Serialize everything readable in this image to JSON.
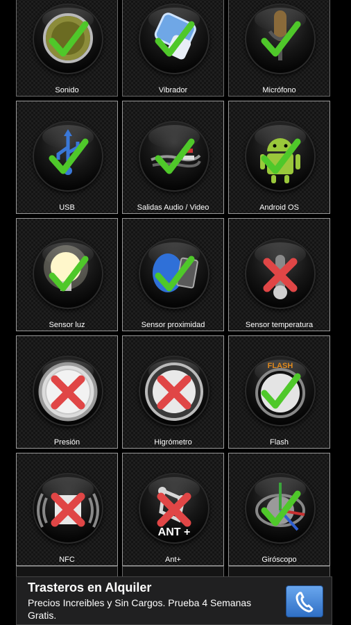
{
  "tiles": [
    {
      "label": "Sonido",
      "icon": "speaker-icon",
      "status": "ok"
    },
    {
      "label": "Vibrador",
      "icon": "battery-icon",
      "status": "ok"
    },
    {
      "label": "Micrófono",
      "icon": "microphone-icon",
      "status": "ok"
    },
    {
      "label": "USB",
      "icon": "usb-icon",
      "status": "ok"
    },
    {
      "label": "Salidas Audio / Video",
      "icon": "audio-cable-icon",
      "status": "ok"
    },
    {
      "label": "Android OS",
      "icon": "android-icon",
      "status": "ok"
    },
    {
      "label": "Sensor luz",
      "icon": "light-bulb-icon",
      "status": "ok"
    },
    {
      "label": "Sensor proximidad",
      "icon": "proximity-icon",
      "status": "ok"
    },
    {
      "label": "Sensor temperatura",
      "icon": "thermometer-icon",
      "status": "fail"
    },
    {
      "label": "Presión",
      "icon": "barometer-icon",
      "status": "fail"
    },
    {
      "label": "Higrómetro",
      "icon": "hygrometer-icon",
      "status": "fail"
    },
    {
      "label": "Flash",
      "icon": "flash-icon",
      "status": "ok",
      "badge": "FLASH"
    },
    {
      "label": "NFC",
      "icon": "nfc-icon",
      "status": "fail"
    },
    {
      "label": "Ant+",
      "icon": "ant-plus-icon",
      "status": "fail",
      "badge": "ANT +"
    },
    {
      "label": "Giróscopo",
      "icon": "gyroscope-icon",
      "status": "ok"
    }
  ],
  "ad": {
    "title": "Trasteros en Alquiler",
    "text": "Precios Increibles y Sin Cargos. Prueba 4 Semanas Gratis.",
    "call_icon": "phone-icon"
  },
  "colors": {
    "ok": "#4fc82a",
    "fail": "#e04646",
    "accent": "#3d7fd8"
  }
}
